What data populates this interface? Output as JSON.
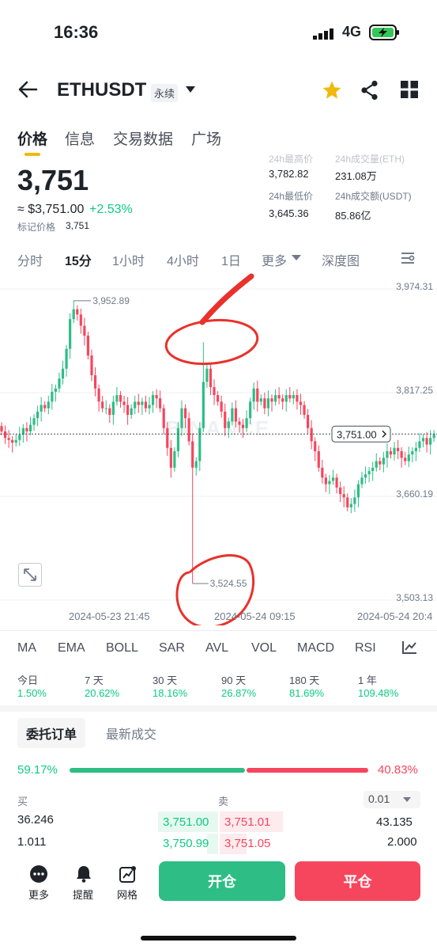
{
  "status_bar": {
    "time": "16:36",
    "network": "4G"
  },
  "header": {
    "symbol": "ETHUSDT",
    "contract_type": "永续",
    "icons": [
      "back-arrow-icon",
      "chevron-down-icon",
      "star-icon",
      "share-icon",
      "grid-icon"
    ],
    "star_color": "#f0b90b"
  },
  "tabs": [
    {
      "label": "价格",
      "active": true
    },
    {
      "label": "信息"
    },
    {
      "label": "交易数据"
    },
    {
      "label": "广场"
    }
  ],
  "price": {
    "last": "3,751",
    "approx": "≈ $3,751.00",
    "change": "+2.53%",
    "mark_label": "标记价格",
    "mark_value": "3,751",
    "stats": [
      {
        "label": "24h最高价",
        "value": "3,782.82"
      },
      {
        "label": "24h成交量(ETH)",
        "value": "231.08万"
      },
      {
        "label": "24h最低价",
        "value": "3,645.36"
      },
      {
        "label": "24h成交额(USDT)",
        "value": "85.86亿"
      }
    ]
  },
  "intervals": [
    {
      "label": "分时"
    },
    {
      "label": "15分",
      "active": true
    },
    {
      "label": "1小时"
    },
    {
      "label": "4小时"
    },
    {
      "label": "1日"
    },
    {
      "label": "更多"
    },
    {
      "label": "深度图"
    }
  ],
  "chart_data": {
    "type": "candlestick",
    "symbol": "ETHUSDT",
    "interval": "15分",
    "ylim": [
      3503.13,
      3974.31
    ],
    "y_ticks": [
      "3,974.31",
      "3,817.25",
      "3,660.19",
      "3,503.13"
    ],
    "x_ticks": [
      "2024-05-23 21:45",
      "2024-05-24 09:15",
      "2024-05-24 20:4"
    ],
    "current_price_label": "3,751.00",
    "current_price": 3751.0,
    "high_marker": {
      "label": "3,952.89",
      "value": 3952.89
    },
    "low_marker": {
      "label": "3,524.55",
      "value": 3524.55
    },
    "watermark": "BINANCE",
    "up_color": "#2ebd85",
    "down_color": "#f6465d",
    "closes": [
      3755,
      3745,
      3742,
      3738,
      3742,
      3750,
      3760,
      3755,
      3765,
      3775,
      3785,
      3795,
      3790,
      3800,
      3815,
      3820,
      3835,
      3850,
      3880,
      3925,
      3940,
      3932,
      3915,
      3900,
      3870,
      3840,
      3820,
      3800,
      3790,
      3790,
      3780,
      3800,
      3810,
      3800,
      3795,
      3780,
      3790,
      3800,
      3795,
      3800,
      3790,
      3795,
      3810,
      3805,
      3790,
      3760,
      3730,
      3700,
      3725,
      3760,
      3790,
      3775,
      3740,
      3700,
      3710,
      3760,
      3830,
      3850,
      3822,
      3810,
      3800,
      3785,
      3760,
      3770,
      3790,
      3770,
      3765,
      3760,
      3775,
      3800,
      3820,
      3800,
      3805,
      3790,
      3805,
      3800,
      3810,
      3805,
      3800,
      3810,
      3805,
      3810,
      3800,
      3795,
      3780,
      3760,
      3740,
      3725,
      3700,
      3685,
      3675,
      3680,
      3685,
      3670,
      3660,
      3655,
      3640,
      3645,
      3655,
      3675,
      3685,
      3690,
      3695,
      3700,
      3710,
      3705,
      3715,
      3725,
      3720,
      3730,
      3725,
      3715,
      3710,
      3720,
      3725,
      3730,
      3740,
      3745,
      3735,
      3745,
      3751
    ]
  },
  "indicators": [
    "MA",
    "EMA",
    "BOLL",
    "SAR",
    "AVL",
    "VOL",
    "MACD",
    "RSI"
  ],
  "periods": [
    {
      "label": "今日",
      "value": "1.50%"
    },
    {
      "label": "7 天",
      "value": "20.62%"
    },
    {
      "label": "30 天",
      "value": "18.16%"
    },
    {
      "label": "90 天",
      "value": "26.87%"
    },
    {
      "label": "180 天",
      "value": "81.69%"
    },
    {
      "label": "1 年",
      "value": "109.48%"
    }
  ],
  "orderbook": {
    "tabs": [
      "委托订单",
      "最新成交"
    ],
    "buy_ratio": "59.17%",
    "sell_ratio": "40.83%",
    "buy_label": "买",
    "sell_label": "卖",
    "precision": "0.01",
    "rows": [
      {
        "bid_qty": "36.246",
        "bid_price": "3,751.00",
        "ask_price": "3,751.01",
        "ask_qty": "43.135"
      },
      {
        "bid_qty": "1.011",
        "bid_price": "3,750.99",
        "ask_price": "3,751.05",
        "ask_qty": "2.000"
      }
    ]
  },
  "bottom_bar": {
    "items": [
      {
        "label": "更多",
        "icon": "more-icon"
      },
      {
        "label": "提醒",
        "icon": "bell-icon"
      },
      {
        "label": "网格",
        "icon": "grid-chart-icon"
      }
    ],
    "open_label": "开仓",
    "close_label": "平仓"
  },
  "annotations": {
    "stroke_color": "#e8322b"
  }
}
